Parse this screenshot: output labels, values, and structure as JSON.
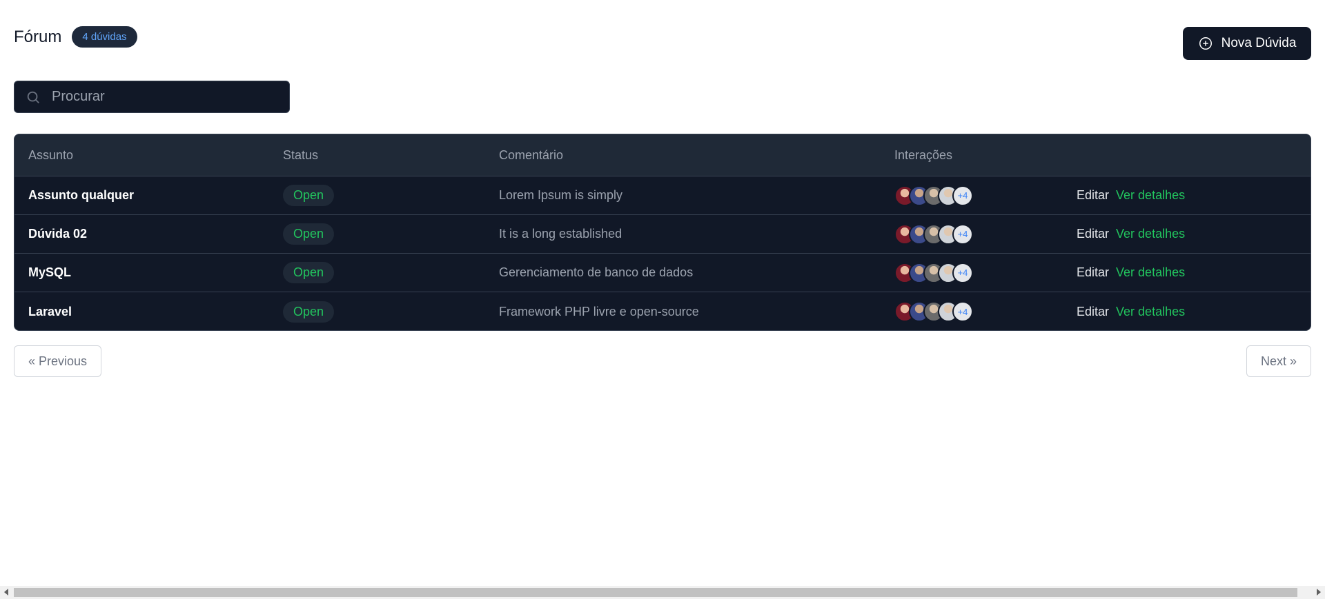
{
  "header": {
    "title": "Fórum",
    "count_badge": "4 dúvidas"
  },
  "actions": {
    "new_question_label": "Nova Dúvida"
  },
  "search": {
    "placeholder": "Procurar",
    "value": ""
  },
  "table": {
    "columns": [
      "Assunto",
      "Status",
      "Comentário",
      "Interações"
    ],
    "rows": [
      {
        "subject": "Assunto qualquer",
        "status": "Open",
        "comment": "Lorem Ipsum is simply",
        "more": "+4",
        "edit": "Editar",
        "details": "Ver detalhes"
      },
      {
        "subject": "Dúvida 02",
        "status": "Open",
        "comment": "It is a long established",
        "more": "+4",
        "edit": "Editar",
        "details": "Ver detalhes"
      },
      {
        "subject": "MySQL",
        "status": "Open",
        "comment": "Gerenciamento de banco de dados",
        "more": "+4",
        "edit": "Editar",
        "details": "Ver detalhes"
      },
      {
        "subject": "Laravel",
        "status": "Open",
        "comment": "Framework PHP livre e open-source",
        "more": "+4",
        "edit": "Editar",
        "details": "Ver detalhes"
      }
    ]
  },
  "pagination": {
    "previous": "« Previous",
    "next": "Next »"
  },
  "colors": {
    "dark": "#111827",
    "accent_green": "#22c55e",
    "badge_blue": "#60a5fa"
  }
}
